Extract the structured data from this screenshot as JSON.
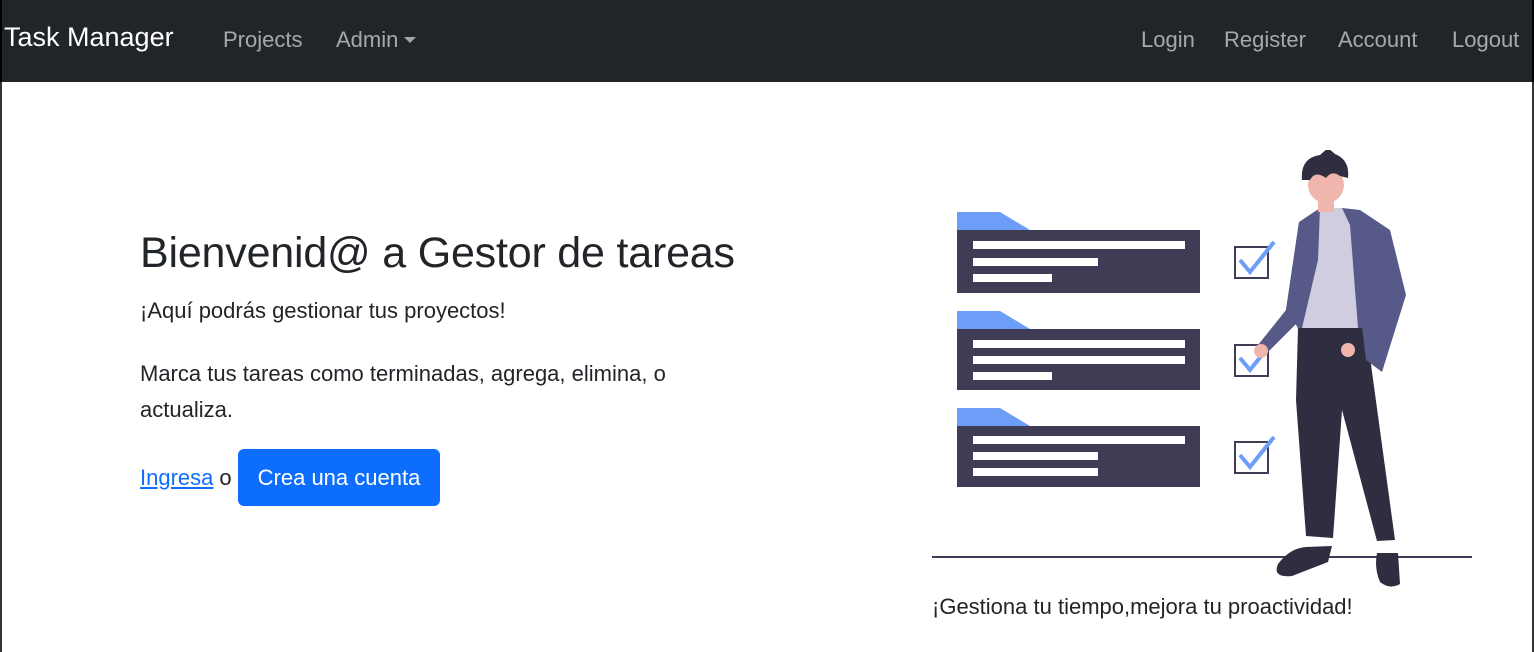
{
  "navbar": {
    "brand": "Task Manager",
    "left_links": [
      "Projects",
      "Admin"
    ],
    "right_links": [
      "Login",
      "Register",
      "Account",
      "Logout"
    ]
  },
  "hero": {
    "title": "Bienvenid@ a Gestor de tareas",
    "subtitle": "¡Aquí podrás gestionar tus proyectos!",
    "description": "Marca tus tareas como terminadas, agrega, elimina, o actualiza.",
    "login_link": "Ingresa",
    "or_text": "o",
    "register_button": "Crea una cuenta"
  },
  "illustration": {
    "caption": "¡Gestiona tu tiempo,mejora tu proactividad!",
    "task_cards": 3,
    "completed_checks": 3
  },
  "colors": {
    "navbar_bg": "#212529",
    "primary": "#0d6efd",
    "card_dark": "#3f3d56",
    "accent_blue": "#6c9ef8"
  }
}
